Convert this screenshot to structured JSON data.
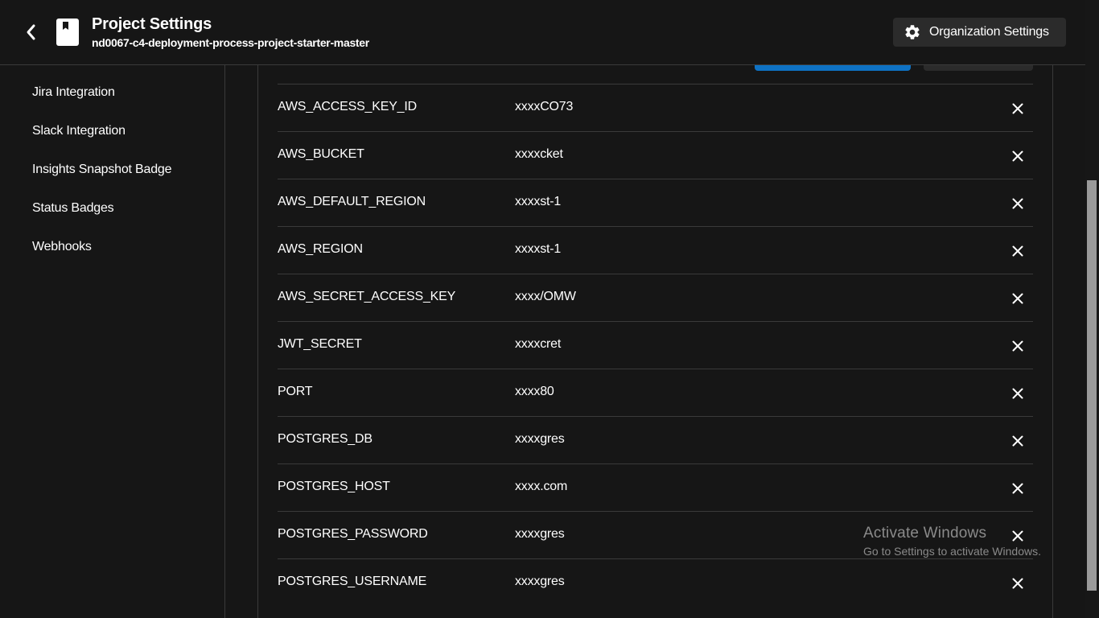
{
  "header": {
    "title": "Project Settings",
    "subtitle": "nd0067-c4-deployment-process-project-starter-master",
    "org_button_label": "Organization Settings",
    "back_icon": "chevron-left-icon",
    "project_icon": "bookmark-book-icon",
    "org_icon": "gear-icon"
  },
  "sidebar": {
    "items": [
      {
        "label": "Jira Integration"
      },
      {
        "label": "Slack Integration"
      },
      {
        "label": "Insights Snapshot Badge"
      },
      {
        "label": "Status Badges"
      },
      {
        "label": "Webhooks"
      }
    ]
  },
  "env_vars": {
    "rows": [
      {
        "name": "AWS_ACCESS_KEY_ID",
        "value": "xxxxCO73"
      },
      {
        "name": "AWS_BUCKET",
        "value": "xxxxcket"
      },
      {
        "name": "AWS_DEFAULT_REGION",
        "value": "xxxxst-1"
      },
      {
        "name": "AWS_REGION",
        "value": "xxxxst-1"
      },
      {
        "name": "AWS_SECRET_ACCESS_KEY",
        "value": "xxxx/OMW"
      },
      {
        "name": "JWT_SECRET",
        "value": "xxxxcret"
      },
      {
        "name": "PORT",
        "value": "xxxx80"
      },
      {
        "name": "POSTGRES_DB",
        "value": "xxxxgres"
      },
      {
        "name": "POSTGRES_HOST",
        "value": "xxxx.com"
      },
      {
        "name": "POSTGRES_PASSWORD",
        "value": "xxxxgres"
      },
      {
        "name": "POSTGRES_USERNAME",
        "value": "xxxxgres"
      }
    ],
    "delete_icon": "close-icon"
  },
  "watermark": {
    "title": "Activate Windows",
    "subtitle": "Go to Settings to activate Windows."
  },
  "colors": {
    "background": "#161616",
    "divider": "#3a3a3a",
    "primary_button": "#0e72c4",
    "secondary_button": "#2b2b2b",
    "watermark_text": "#8a8a8a"
  }
}
